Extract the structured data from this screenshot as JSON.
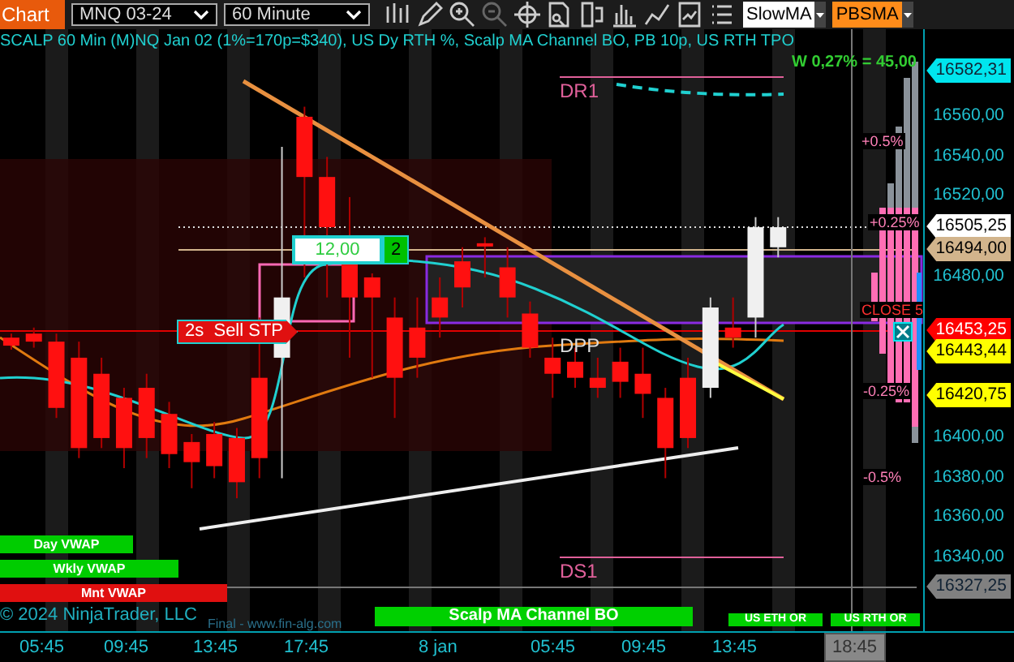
{
  "toolbar": {
    "tab": "Chart",
    "instrument": "MNQ 03-24",
    "interval": "60 Minute",
    "indicators": [
      {
        "label": "SlowMA",
        "color": "#ffffff"
      },
      {
        "label": "PBSMA",
        "color": "#ff8c1a"
      }
    ]
  },
  "chart": {
    "title": "SCALP 60 Min (M)NQ  Jan 02 (1%=170p=$340), US Dy RTH %, Scalp MA Channel BO, PB 10p, US RTH TPO",
    "stat": "W 0,27% = 45,00",
    "levels": [
      {
        "label": "DR1",
        "kind": "line"
      },
      {
        "label": "DPP",
        "kind": "text"
      },
      {
        "label": "DS1",
        "kind": "line"
      }
    ],
    "chart_data": {
      "type": "candlestick",
      "ylim": [
        16303,
        16603.6
      ],
      "categories": [
        null,
        null,
        null,
        null,
        null,
        null,
        null,
        null,
        null,
        null,
        null,
        null,
        null,
        null,
        null,
        null,
        null,
        null,
        null,
        null,
        null,
        null,
        null,
        null,
        null,
        null,
        null,
        null,
        null,
        null,
        null,
        null,
        null,
        null,
        null,
        null,
        null,
        null,
        null,
        null,
        null
      ],
      "yticks": [
        {
          "value": 16560,
          "label": "16560,00"
        },
        {
          "value": 16540,
          "label": "16540,00"
        },
        {
          "value": 16520,
          "label": "16520,00"
        },
        {
          "value": 16480,
          "label": "16480,00"
        },
        {
          "value": 16400,
          "label": "16400,00"
        },
        {
          "value": 16380,
          "label": "16380,00"
        },
        {
          "value": 16360,
          "label": "16360,00"
        },
        {
          "value": 16340,
          "label": "16340,00"
        }
      ],
      "ohlc": [
        [
          16450,
          16452,
          16444,
          16446
        ],
        [
          16452,
          16455,
          16445,
          16448
        ],
        [
          16448,
          16452,
          16410,
          16415
        ],
        [
          16440,
          16448,
          16390,
          16395
        ],
        [
          16432,
          16440,
          16395,
          16400
        ],
        [
          16420,
          16425,
          16385,
          16395
        ],
        [
          16425,
          16432,
          16390,
          16400
        ],
        [
          16412,
          16418,
          16385,
          16392
        ],
        [
          16398,
          16402,
          16375,
          16388
        ],
        [
          16402,
          16408,
          16380,
          16386
        ],
        [
          16400,
          16405,
          16370,
          16378
        ],
        [
          16430,
          16460,
          16380,
          16390
        ],
        [
          16440,
          16545,
          16380,
          16470
        ],
        [
          16560,
          16565,
          16480,
          16530
        ],
        [
          16530,
          16540,
          16470,
          16505
        ],
        [
          16500,
          16520,
          16440,
          16470
        ],
        [
          16480,
          16482,
          16430,
          16470
        ],
        [
          16460,
          16470,
          16410,
          16430
        ],
        [
          16455,
          16470,
          16430,
          16440
        ],
        [
          16470,
          16480,
          16450,
          16460
        ],
        [
          16488,
          16495,
          16465,
          16475
        ],
        [
          16497,
          16500,
          16480,
          16496
        ],
        [
          16485,
          16495,
          16460,
          16470
        ],
        [
          16462,
          16468,
          16440,
          16445
        ],
        [
          16440,
          16450,
          16420,
          16432
        ],
        [
          16438,
          16445,
          16425,
          16430
        ],
        [
          16430,
          16440,
          16420,
          16425
        ],
        [
          16438,
          16445,
          16420,
          16428
        ],
        [
          16432,
          16445,
          16410,
          16422
        ],
        [
          16420,
          16425,
          16380,
          16395
        ],
        [
          16430,
          16440,
          16395,
          16400
        ],
        [
          16425,
          16470,
          16420,
          16465
        ],
        [
          16455,
          16470,
          16445,
          16450
        ],
        [
          16460,
          16510,
          16450,
          16505
        ],
        [
          16495,
          16510,
          16490,
          16505
        ],
        null,
        null,
        null,
        null,
        null,
        null
      ]
    },
    "percent_labels": [
      {
        "label": "+0.5%",
        "kind": "pct"
      },
      {
        "label": "+0.25%",
        "kind": "pct"
      },
      {
        "label": "CLOSE 5",
        "kind": "close"
      },
      {
        "label": "-0.25%",
        "kind": "pct"
      },
      {
        "label": "-0.5%",
        "kind": "pct"
      }
    ],
    "order": {
      "price": "12,00",
      "quantity": "2",
      "tag": "2s  Sell STP"
    },
    "bars": [
      {
        "label": "Day VWAP",
        "color": "#00cc00"
      },
      {
        "label": "Wkly VWAP",
        "color": "#00cc00"
      },
      {
        "label": "Mnt VWAP",
        "color": "#e01010"
      }
    ],
    "copyright": "© 2024 NinjaTrader, LLC",
    "vendor": "Final - www.fin-alg.com",
    "session_bars": [
      {
        "label": "Scalp MA Channel BO",
        "kind": "wide"
      },
      {
        "label": "US ETH OR",
        "kind": "small"
      },
      {
        "label": "US RTH OR",
        "kind": "small"
      }
    ]
  },
  "price_axis": {
    "tags": [
      {
        "label": "16582,31",
        "color": "#00e5ee"
      },
      {
        "label": "16505,25",
        "color": "#ffffff"
      },
      {
        "label": "16494,00",
        "color": "#d2b48c"
      },
      {
        "label": "16453,25",
        "color": "#ff0000"
      },
      {
        "label": "16443,44",
        "color": "#ffff00"
      },
      {
        "label": "16420,75",
        "color": "#ffff00"
      },
      {
        "label": "16327,25",
        "color": "#808080"
      }
    ]
  },
  "time_axis": {
    "labels": [
      "05:45",
      "09:45",
      "13:45",
      "17:45",
      "8 jan",
      "05:45",
      "09:45",
      "13:45"
    ],
    "cursor": "18:45"
  }
}
